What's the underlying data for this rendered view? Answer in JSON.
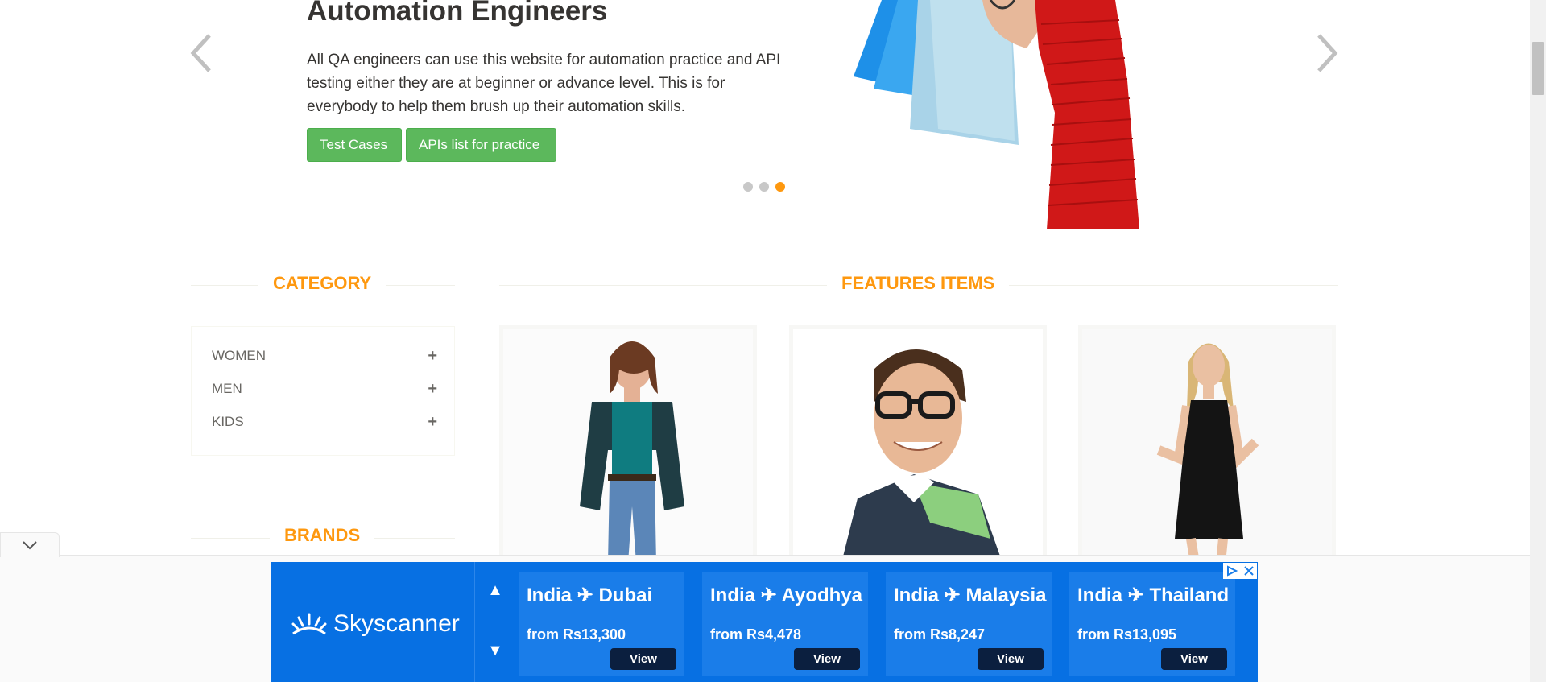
{
  "hero": {
    "title": "Automation Engineers",
    "description": "All QA engineers can use this website for automation practice and API testing either they are at beginner or advance level. This is for everybody to help them brush up their automation skills.",
    "btn_test_cases": "Test Cases",
    "btn_apis": "APIs list for practice",
    "active_slide": 3,
    "slide_count": 3
  },
  "category": {
    "title": "CATEGORY",
    "items": [
      {
        "label": "WOMEN",
        "icon": "plus-icon"
      },
      {
        "label": "MEN",
        "icon": "plus-icon"
      },
      {
        "label": "KIDS",
        "icon": "plus-icon"
      }
    ]
  },
  "brands": {
    "title": "BRANDS"
  },
  "features": {
    "title": "FEATURES ITEMS"
  },
  "ad": {
    "brand": "Skyscanner",
    "deals": [
      {
        "route": "India ✈ Dubai",
        "price": "from Rs13,300",
        "cta": "View"
      },
      {
        "route": "India ✈ Ayodhya",
        "price": "from Rs4,478",
        "cta": "View"
      },
      {
        "route": "India ✈ Malaysia",
        "price": "from Rs8,247",
        "cta": "View"
      },
      {
        "route": "India ✈ Thailand",
        "price": "from Rs13,095",
        "cta": "View"
      }
    ]
  },
  "colors": {
    "accent": "#fe980f",
    "button_green": "#5cb85c",
    "ad_blue": "#0770e3"
  }
}
